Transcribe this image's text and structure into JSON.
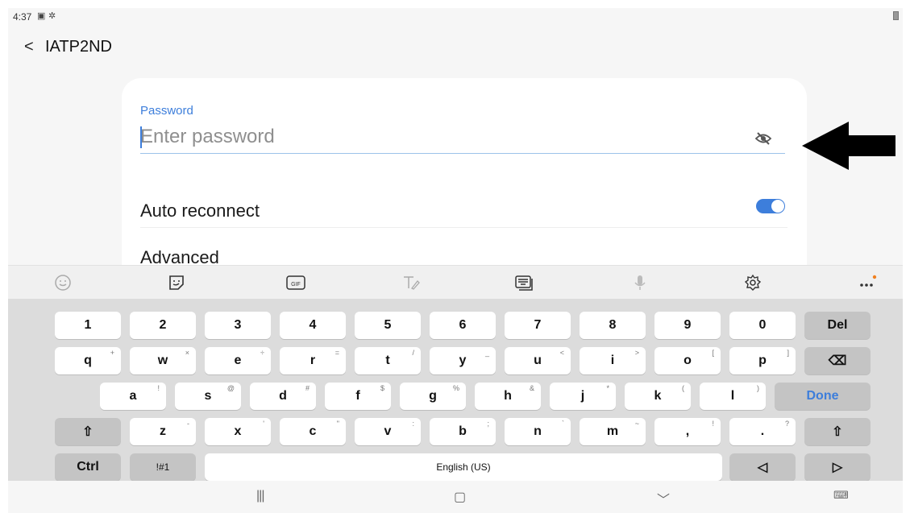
{
  "status_bar": {
    "time": "4:37",
    "icons": [
      "image-icon",
      "gear-icon"
    ]
  },
  "header": {
    "back_label": "<",
    "title": "IATP2ND"
  },
  "form": {
    "password_label": "Password",
    "password_placeholder": "Enter password",
    "password_value": "",
    "show_password_icon": "eye-off-icon",
    "auto_reconnect_label": "Auto reconnect",
    "auto_reconnect_on": true,
    "advanced_label": "Advanced"
  },
  "annotation": {
    "arrow_icon": "black-left-arrow",
    "color": "#000000"
  },
  "keyboard": {
    "toolbar": [
      "emoji-icon",
      "sticker-icon",
      "gif-icon",
      "handwriting-icon",
      "keyboard-mode-icon",
      "mic-icon",
      "settings-icon",
      "more-icon"
    ],
    "row1": [
      {
        "main": "1"
      },
      {
        "main": "2"
      },
      {
        "main": "3"
      },
      {
        "main": "4"
      },
      {
        "main": "5"
      },
      {
        "main": "6"
      },
      {
        "main": "7"
      },
      {
        "main": "8"
      },
      {
        "main": "9"
      },
      {
        "main": "0"
      },
      {
        "main": "Del"
      }
    ],
    "row2": [
      {
        "main": "q",
        "sec": "+"
      },
      {
        "main": "w",
        "sec": "×"
      },
      {
        "main": "e",
        "sec": "÷"
      },
      {
        "main": "r",
        "sec": "="
      },
      {
        "main": "t",
        "sec": "/"
      },
      {
        "main": "y",
        "sec": "_"
      },
      {
        "main": "u",
        "sec": "<"
      },
      {
        "main": "i",
        "sec": ">"
      },
      {
        "main": "o",
        "sec": "["
      },
      {
        "main": "p",
        "sec": "]"
      },
      {
        "main": "⌫"
      }
    ],
    "row3": [
      {
        "main": "a",
        "sec": "!"
      },
      {
        "main": "s",
        "sec": "@"
      },
      {
        "main": "d",
        "sec": "#"
      },
      {
        "main": "f",
        "sec": "$"
      },
      {
        "main": "g",
        "sec": "%"
      },
      {
        "main": "h",
        "sec": "&"
      },
      {
        "main": "j",
        "sec": "*"
      },
      {
        "main": "k",
        "sec": "("
      },
      {
        "main": "l",
        "sec": ")"
      },
      {
        "main": "Done"
      }
    ],
    "row4": [
      {
        "main": "⇧"
      },
      {
        "main": "z",
        "sec": "-"
      },
      {
        "main": "x",
        "sec": "'"
      },
      {
        "main": "c",
        "sec": "\""
      },
      {
        "main": "v",
        "sec": ":"
      },
      {
        "main": "b",
        "sec": ";"
      },
      {
        "main": "n",
        "sec": "`"
      },
      {
        "main": "m",
        "sec": "~"
      },
      {
        "main": ",",
        "sec": "!"
      },
      {
        "main": ".",
        "sec": "?"
      },
      {
        "main": "⇧"
      }
    ],
    "row5": [
      {
        "main": "Ctrl"
      },
      {
        "main": "!#1"
      },
      {
        "main": "English (US)"
      },
      {
        "main": "◁"
      },
      {
        "main": "▷"
      }
    ],
    "accent_color": "#3d7edb"
  },
  "navigation": {
    "recents": "|||",
    "home": "▢",
    "back": "﹀",
    "keyboard_hide": "⌨"
  }
}
